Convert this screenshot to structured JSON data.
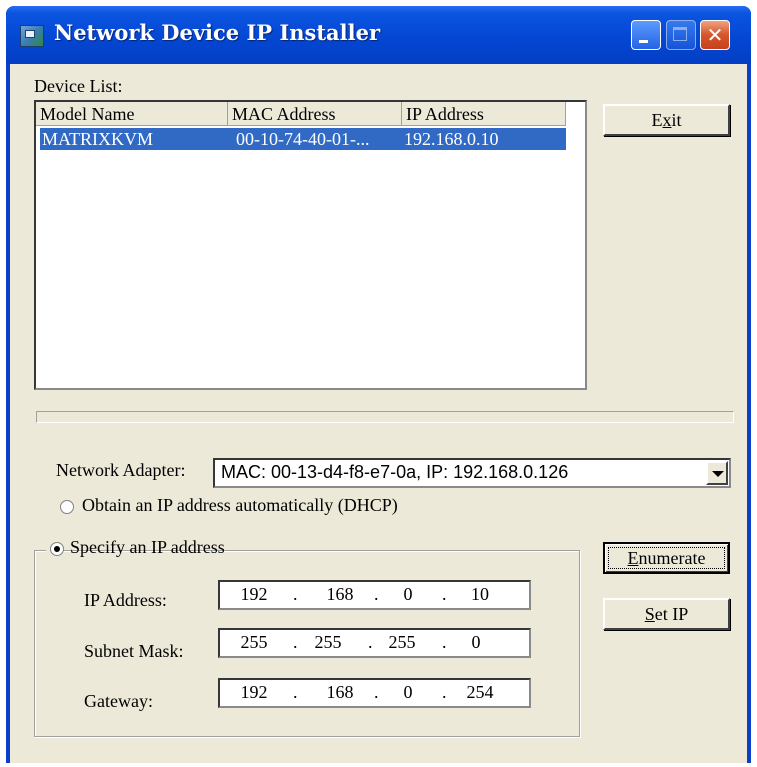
{
  "window": {
    "title": "Network Device IP Installer",
    "close_glyph": "✕"
  },
  "device_list": {
    "label": "Device List:",
    "columns": [
      "Model Name",
      "MAC Address",
      "IP Address"
    ],
    "rows": [
      {
        "model": "MATRIXKVM",
        "mac": "00-10-74-40-01-...",
        "ip": "192.168.0.10",
        "selected": true
      }
    ]
  },
  "buttons": {
    "exit": {
      "pre": "E",
      "mnemonic": "x",
      "post": "it"
    },
    "enumerate": {
      "pre": "",
      "mnemonic": "E",
      "post": "numerate"
    },
    "set_ip": {
      "pre": "",
      "mnemonic": "S",
      "post": "et IP"
    }
  },
  "network_adapter": {
    "label": "Network Adapter:",
    "value": "MAC: 00-13-d4-f8-e7-0a,   IP: 192.168.0.126"
  },
  "dhcp_option": {
    "label": "Obtain an IP address automatically (DHCP)",
    "checked": false
  },
  "static_option": {
    "label": "Specify an IP address",
    "checked": true
  },
  "ip_fields": {
    "ip_address": {
      "label": "IP Address:",
      "octets": [
        "192",
        "168",
        "0",
        "10"
      ]
    },
    "subnet_mask": {
      "label": "Subnet Mask:",
      "octets": [
        "255",
        "255",
        "255",
        "0"
      ]
    },
    "gateway": {
      "label": "Gateway:",
      "octets": [
        "192",
        "168",
        "0",
        "254"
      ]
    }
  },
  "colors": {
    "title_bar": "#0447d3",
    "selection": "#316ac5",
    "face": "#ece9d8"
  }
}
